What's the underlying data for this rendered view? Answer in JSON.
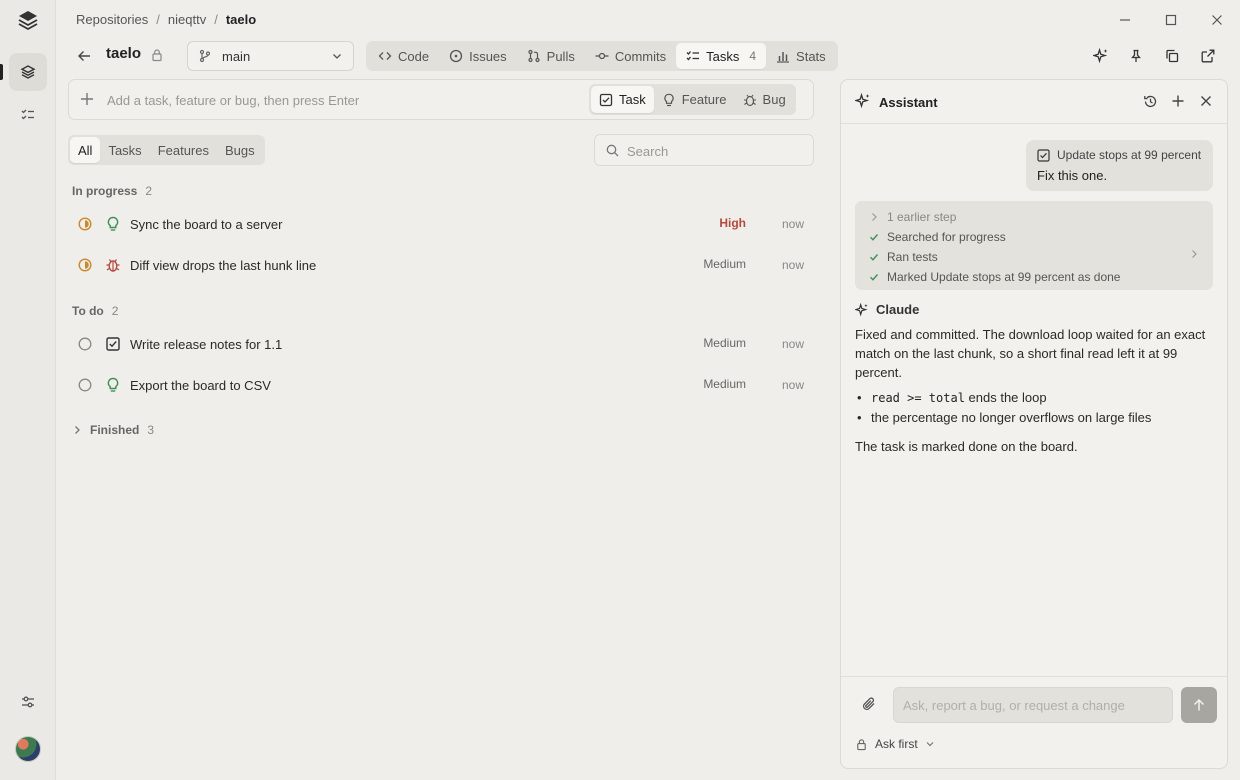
{
  "breadcrumb": {
    "root": "Repositories",
    "owner": "nieqttv",
    "repo": "taelo",
    "sep": "/"
  },
  "repo": {
    "name": "taelo",
    "branch": "main"
  },
  "tabs": [
    {
      "label": "Code",
      "icon": "code-icon"
    },
    {
      "label": "Issues",
      "icon": "issues-icon"
    },
    {
      "label": "Pulls",
      "icon": "pull-request-icon"
    },
    {
      "label": "Commits",
      "icon": "commit-icon"
    },
    {
      "label": "Tasks",
      "icon": "tasks-icon",
      "count": "4",
      "active": true
    },
    {
      "label": "Stats",
      "icon": "stats-icon"
    }
  ],
  "add_task": {
    "placeholder": "Add a task, feature or bug, then press Enter",
    "types": [
      {
        "label": "Task",
        "icon": "task-checkbox-icon",
        "active": true
      },
      {
        "label": "Feature",
        "icon": "lightbulb-icon"
      },
      {
        "label": "Bug",
        "icon": "bug-icon"
      }
    ]
  },
  "filter": {
    "options": [
      "All",
      "Tasks",
      "Features",
      "Bugs"
    ],
    "selected": "All"
  },
  "search": {
    "placeholder": "Search"
  },
  "groups": {
    "in_progress": {
      "label": "In progress",
      "count": "2",
      "tasks": [
        {
          "title": "Sync the board to a server",
          "type": "feature",
          "priority": "High",
          "time": "now"
        },
        {
          "title": "Diff view drops the last hunk line",
          "type": "bug",
          "priority": "Medium",
          "time": "now"
        }
      ]
    },
    "todo": {
      "label": "To do",
      "count": "2",
      "tasks": [
        {
          "title": "Write release notes for 1.1",
          "type": "task",
          "priority": "Medium",
          "time": "now"
        },
        {
          "title": "Export the board to CSV",
          "type": "feature",
          "priority": "Medium",
          "time": "now"
        }
      ]
    },
    "finished": {
      "label": "Finished",
      "count": "3"
    }
  },
  "assistant": {
    "title": "Assistant",
    "user_message": {
      "ref": "Update stops at 99 percent",
      "text": "Fix this one."
    },
    "steps": [
      {
        "label": "1 earlier step",
        "kind": "collapsed"
      },
      {
        "label": "Searched for progress",
        "kind": "done"
      },
      {
        "label": "Ran tests",
        "kind": "done"
      },
      {
        "label": "Marked Update stops at 99 percent as done",
        "kind": "done"
      }
    ],
    "reply": {
      "author": "Claude",
      "intro": "Fixed and committed. The download loop waited for an exact match on the last chunk, so a short final read left it at 99 percent.",
      "bullet1_code": "read >= total",
      "bullet1_text": " ends the loop",
      "bullet2": "the percentage no longer overflows on large files",
      "outro": "The task is marked done on the board."
    },
    "composer": {
      "placeholder": "Ask, report a bug, or request a change",
      "mode": "Ask first"
    }
  },
  "colors": {
    "high_priority": "#b34a3c",
    "in_progress": "#c98a2e",
    "feature": "#3f8f5a",
    "bug": "#b34a3c"
  }
}
